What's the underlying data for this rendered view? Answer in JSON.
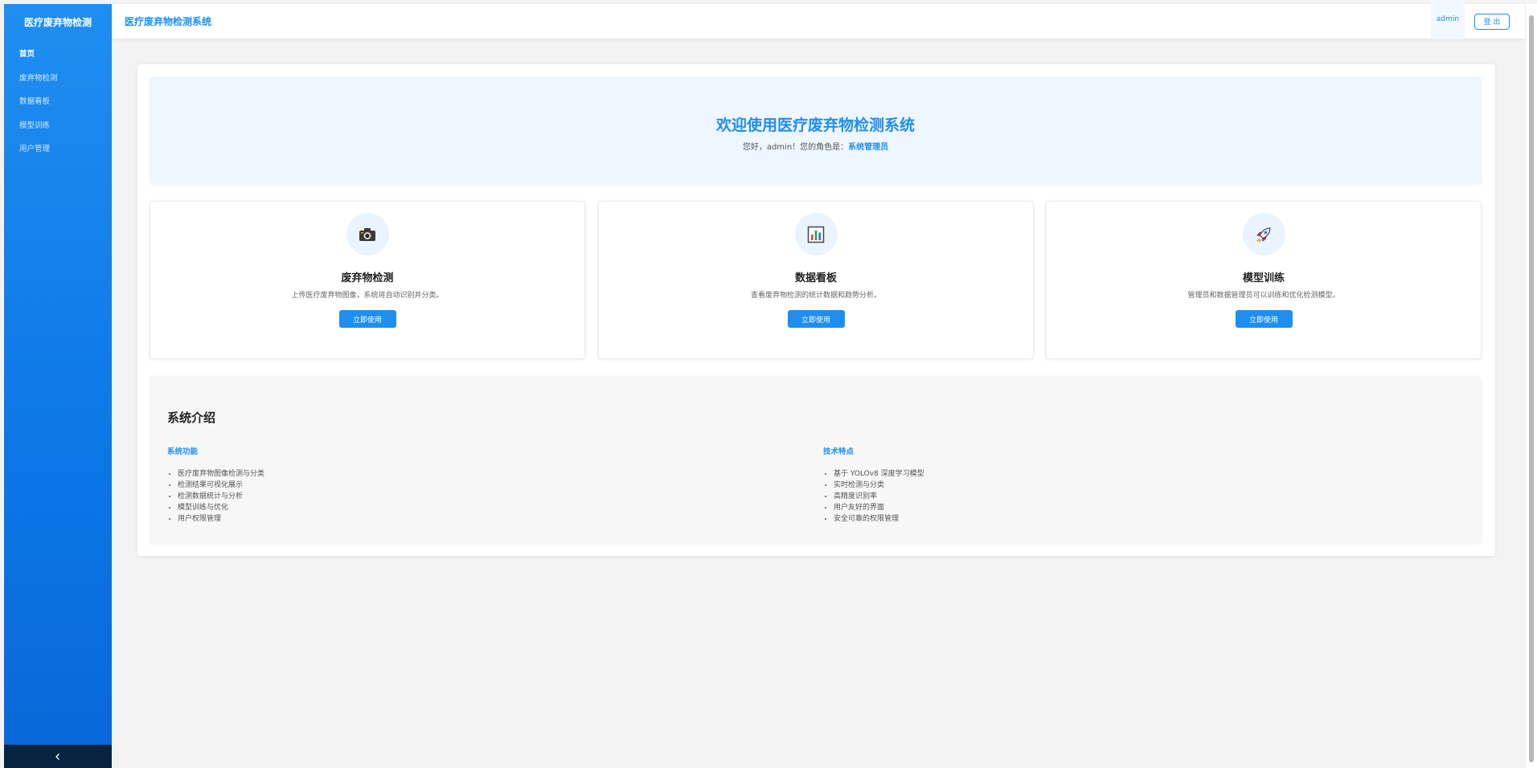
{
  "sidebar": {
    "brand": "医疗废弃物检测",
    "items": [
      {
        "label": "首页"
      },
      {
        "label": "废弃物检测"
      },
      {
        "label": "数据看板"
      },
      {
        "label": "模型训练"
      },
      {
        "label": "用户管理"
      }
    ]
  },
  "header": {
    "title": "医疗废弃物检测系统",
    "username": "admin",
    "logout_label": "登 出"
  },
  "welcome": {
    "title": "欢迎使用医疗废弃物检测系统",
    "greeting": "您好，admin！您的角色是：",
    "role": "系统管理员"
  },
  "features": [
    {
      "title": "废弃物检测",
      "desc": "上传医疗废弃物图像，系统将自动识别并分类。",
      "button": "立即使用",
      "icon": "📷"
    },
    {
      "title": "数据看板",
      "desc": "查看废弃物检测的统计数据和趋势分析。",
      "button": "立即使用",
      "icon": "📊"
    },
    {
      "title": "模型训练",
      "desc": "管理员和数据管理员可以训练和优化检测模型。",
      "button": "立即使用",
      "icon": "🚀"
    }
  ],
  "intro": {
    "title": "系统介绍",
    "functions": {
      "heading": "系统功能",
      "items": [
        "医疗废弃物图像检测与分类",
        "检测结果可视化展示",
        "检测数据统计与分析",
        "模型训练与优化",
        "用户权限管理"
      ]
    },
    "tech": {
      "heading": "技术特点",
      "items": [
        "基于 YOLOv8 深度学习模型",
        "实时检测与分类",
        "高精度识别率",
        "用户友好的界面",
        "安全可靠的权限管理"
      ]
    }
  },
  "colors": {
    "accent": "#1f8ef1",
    "sidebar_bottom": "#06233f"
  }
}
